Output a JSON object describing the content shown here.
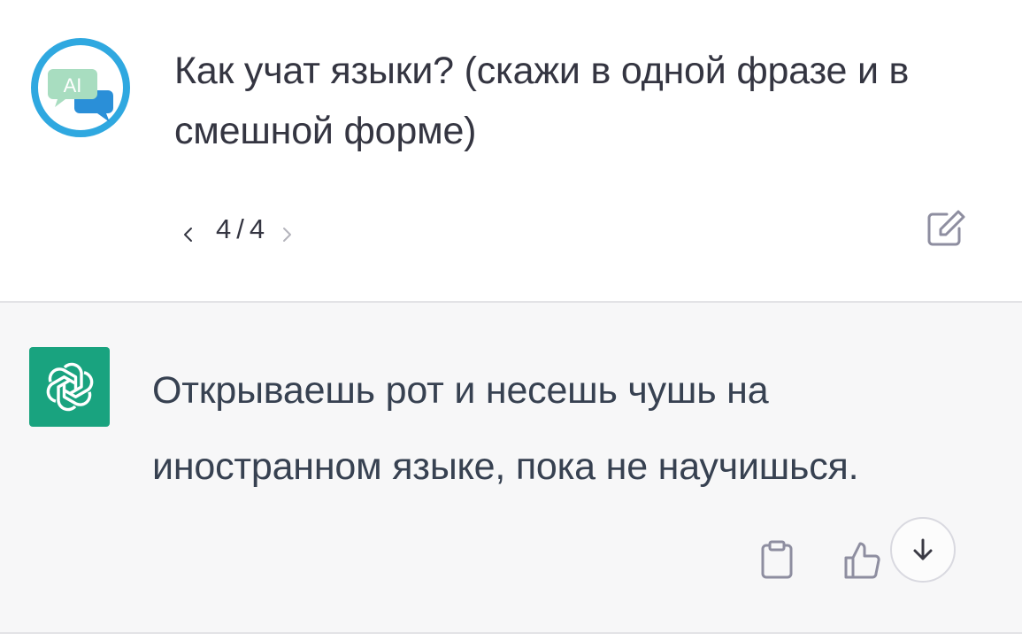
{
  "conversation": {
    "user_message": {
      "avatar": {
        "icon": "ai-chat-bubble-icon",
        "label": "AI"
      },
      "text": "Как учат языки? (скажи в одной фразе и в смешной форме)",
      "pager": {
        "current": "4",
        "separator": "/",
        "total": "4"
      },
      "edit_icon": "edit-icon"
    },
    "assistant_message": {
      "avatar_icon": "openai-logo-icon",
      "text": "Открываешь рот и несешь чушь на иностранном языке, пока не научишься.",
      "actions": {
        "copy_icon": "clipboard-icon",
        "like_icon": "thumbs-up-icon",
        "scroll_icon": "arrow-down-icon"
      }
    }
  },
  "colors": {
    "user_background": "#ffffff",
    "assistant_background": "#f7f7f8",
    "text": "#343541",
    "brand_green": "#19a37f",
    "avatar_ring": "#2fa8e0",
    "avatar_bubble_green": "#a8ddc0",
    "avatar_bubble_blue": "#2a8fd8"
  }
}
